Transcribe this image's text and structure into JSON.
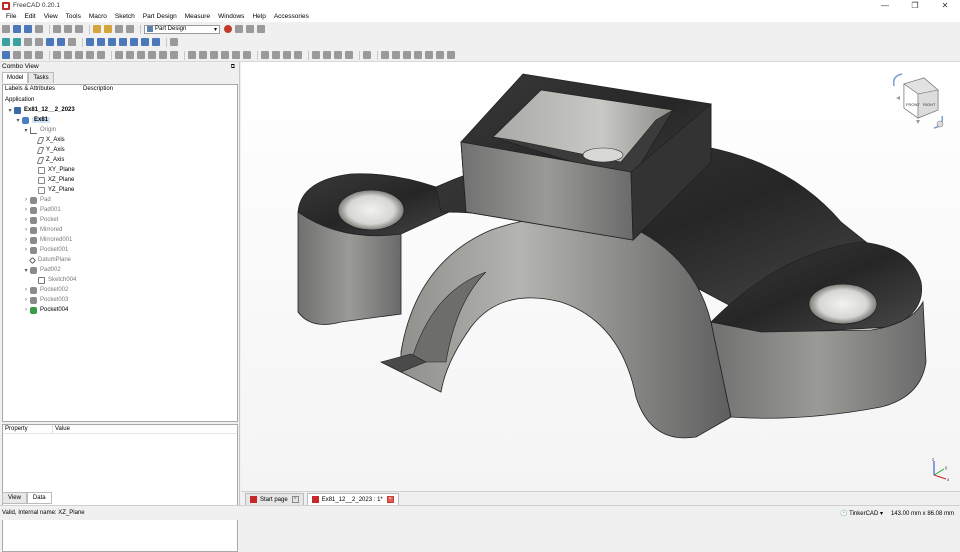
{
  "window": {
    "title": "FreeCAD 0.20.1",
    "minimize": "—",
    "maximize": "❐",
    "close": "✕"
  },
  "menu": [
    "File",
    "Edit",
    "View",
    "Tools",
    "Macro",
    "Sketch",
    "Part Design",
    "Measure",
    "Windows",
    "Help",
    "Accessories"
  ],
  "toolbar": {
    "workbench": "Part Design"
  },
  "combo": {
    "title": "Combo View",
    "tabs": [
      "Model",
      "Tasks"
    ],
    "tree_headers": [
      "Labels & Attributes",
      "Description"
    ],
    "tree_root": "Application",
    "items": [
      {
        "label": "Ex81_12__2_2023",
        "style": "bold",
        "icon": "doc"
      },
      {
        "label": "Ex81",
        "style": "body",
        "icon": "body"
      },
      {
        "label": "Origin",
        "style": "grey",
        "icon": "origin"
      },
      {
        "label": "X_Axis",
        "style": "",
        "icon": "axis"
      },
      {
        "label": "Y_Axis",
        "style": "",
        "icon": "axis"
      },
      {
        "label": "Z_Axis",
        "style": "",
        "icon": "axis"
      },
      {
        "label": "XY_Plane",
        "style": "",
        "icon": "plane"
      },
      {
        "label": "XZ_Plane",
        "style": "",
        "icon": "plane"
      },
      {
        "label": "YZ_Plane",
        "style": "",
        "icon": "plane"
      },
      {
        "label": "Pad",
        "style": "grey",
        "icon": "feat"
      },
      {
        "label": "Pad001",
        "style": "grey",
        "icon": "feat"
      },
      {
        "label": "Pocket",
        "style": "grey",
        "icon": "feat"
      },
      {
        "label": "Mirrored",
        "style": "grey",
        "icon": "feat"
      },
      {
        "label": "Mirrored001",
        "style": "grey",
        "icon": "feat"
      },
      {
        "label": "Pocket001",
        "style": "grey",
        "icon": "feat"
      },
      {
        "label": "DatumPlane",
        "style": "grey",
        "icon": "datum"
      },
      {
        "label": "Pad002",
        "style": "grey",
        "icon": "feat"
      },
      {
        "label": "Sketch004",
        "style": "grey",
        "icon": "sketch"
      },
      {
        "label": "Pocket002",
        "style": "grey",
        "icon": "feat"
      },
      {
        "label": "Pocket003",
        "style": "grey",
        "icon": "feat"
      },
      {
        "label": "Pocket004",
        "style": "",
        "icon": "tip"
      }
    ],
    "property_headers": [
      "Property",
      "Value"
    ],
    "bottom_tabs": [
      "View",
      "Data"
    ]
  },
  "navcube": {
    "front": "FRONT",
    "right": "RIGHT"
  },
  "doc_tabs": [
    {
      "label": "Start page",
      "active": false
    },
    {
      "label": "Ex81_12__2_2023 : 1*",
      "active": true
    }
  ],
  "status": {
    "message": "Valid, Internal name: XZ_Plane",
    "navigation": "TinkerCAD",
    "dimensions": "143.00 mm x 86.08 mm"
  },
  "colors": {
    "selection": "#cde3f7",
    "tip_feature": "#3c9b4a",
    "brand": "#c62828"
  }
}
